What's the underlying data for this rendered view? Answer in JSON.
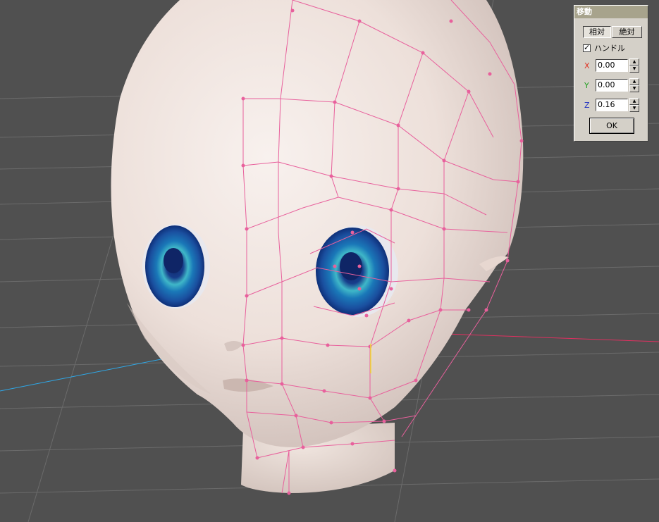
{
  "window": {
    "title": "移動",
    "mode_relative_label": "相対",
    "mode_absolute_label": "絶対",
    "mode_selected": "relative",
    "handle_checkbox_label": "ハンドル",
    "handle_checked": true,
    "x_label": "X",
    "y_label": "Y",
    "z_label": "Z",
    "x_value": "0.00",
    "y_value": "0.00",
    "z_value": "0.16",
    "ok_label": "OK",
    "colors": {
      "x_axis": "#e03020",
      "y_axis": "#20a020",
      "z_axis": "#2030c0",
      "panel_bg": "#d4d0c8",
      "title_bg": "#a7a38c"
    }
  },
  "scene": {
    "background_color": "#505050",
    "wireframe_color": "#e8609c",
    "skin_color": "#f0e4dc",
    "iris_color": "#1a5fa8",
    "x_axis_line_color": "#e03060",
    "z_axis_line_color": "#2ea8e8"
  }
}
